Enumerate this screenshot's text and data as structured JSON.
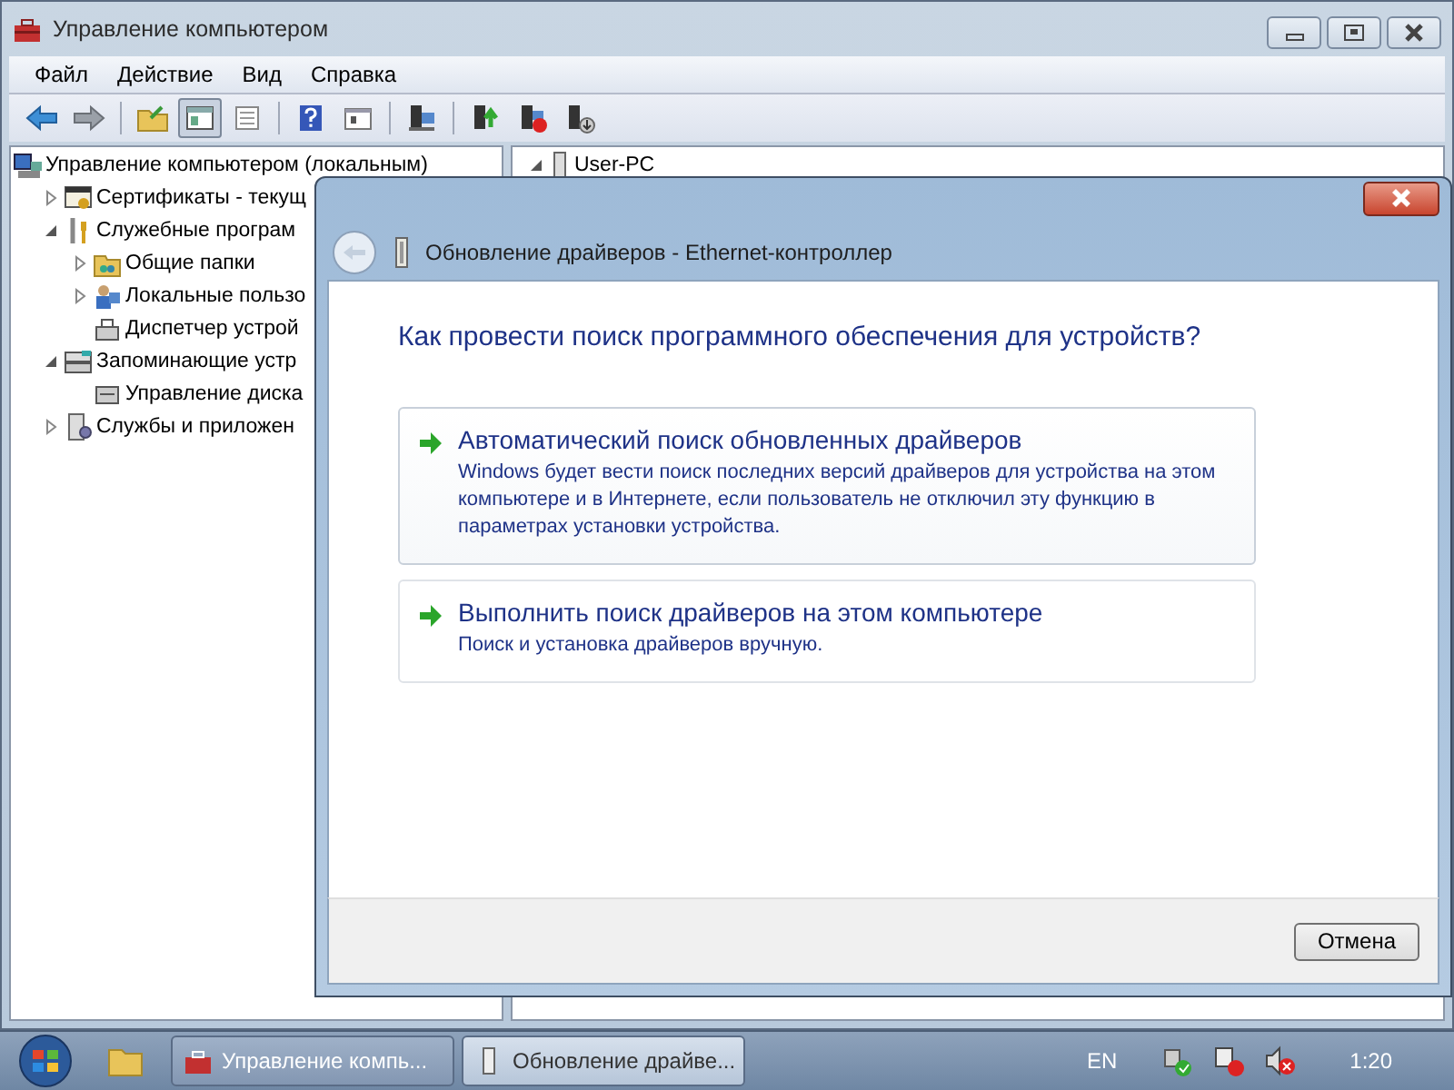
{
  "window": {
    "title": "Управление компьютером"
  },
  "menu": [
    "Файл",
    "Действие",
    "Вид",
    "Справка"
  ],
  "toolbar": [
    {
      "pressed": false
    },
    {
      "pressed": false
    },
    {
      "pressed": false
    },
    {
      "pressed": true
    },
    {
      "pressed": false
    },
    {
      "pressed": false
    },
    {
      "pressed": false
    },
    {
      "pressed": false
    },
    {
      "pressed": false
    },
    {
      "pressed": false
    },
    {
      "pressed": false
    }
  ],
  "tree": [
    {
      "label": "Управление компьютером (локальным)",
      "children": [
        {
          "label": "Сертификаты - текущ",
          "expanded": false
        },
        {
          "label": "Служебные програм",
          "expanded": true,
          "children": [
            {
              "label": "Общие папки",
              "expanded": false
            },
            {
              "label": "Локальные пользо",
              "expanded": false
            },
            {
              "label": "Диспетчер устрой"
            }
          ]
        },
        {
          "label": "Запоминающие устр",
          "expanded": true,
          "children": [
            {
              "label": "Управление диска"
            }
          ]
        },
        {
          "label": "Службы и приложен",
          "expanded": false
        }
      ]
    }
  ],
  "right_pane": {
    "label": "User-PC",
    "expanded": true
  },
  "dialog": {
    "title": "Обновление драйверов - Ethernet-контроллер",
    "question": "Как провести поиск программного обеспечения для устройств?",
    "options": [
      {
        "title": "Автоматический поиск обновленных драйверов",
        "description": "Windows будет вести поиск последних версий драйверов для устройства на этом компьютере и в Интернете, если пользователь не отключил эту функцию в параметрах установки устройства.",
        "hovered": true
      },
      {
        "title": "Выполнить поиск драйверов на этом компьютере",
        "description": "Поиск и установка драйверов вручную.",
        "hovered": false
      }
    ],
    "cancel": "Отмена"
  },
  "taskbar": {
    "tasks": [
      {
        "label": "Управление компь...",
        "active": false
      },
      {
        "label": "Обновление драйве...",
        "active": true
      }
    ],
    "language": "EN",
    "clock": "1:20"
  }
}
